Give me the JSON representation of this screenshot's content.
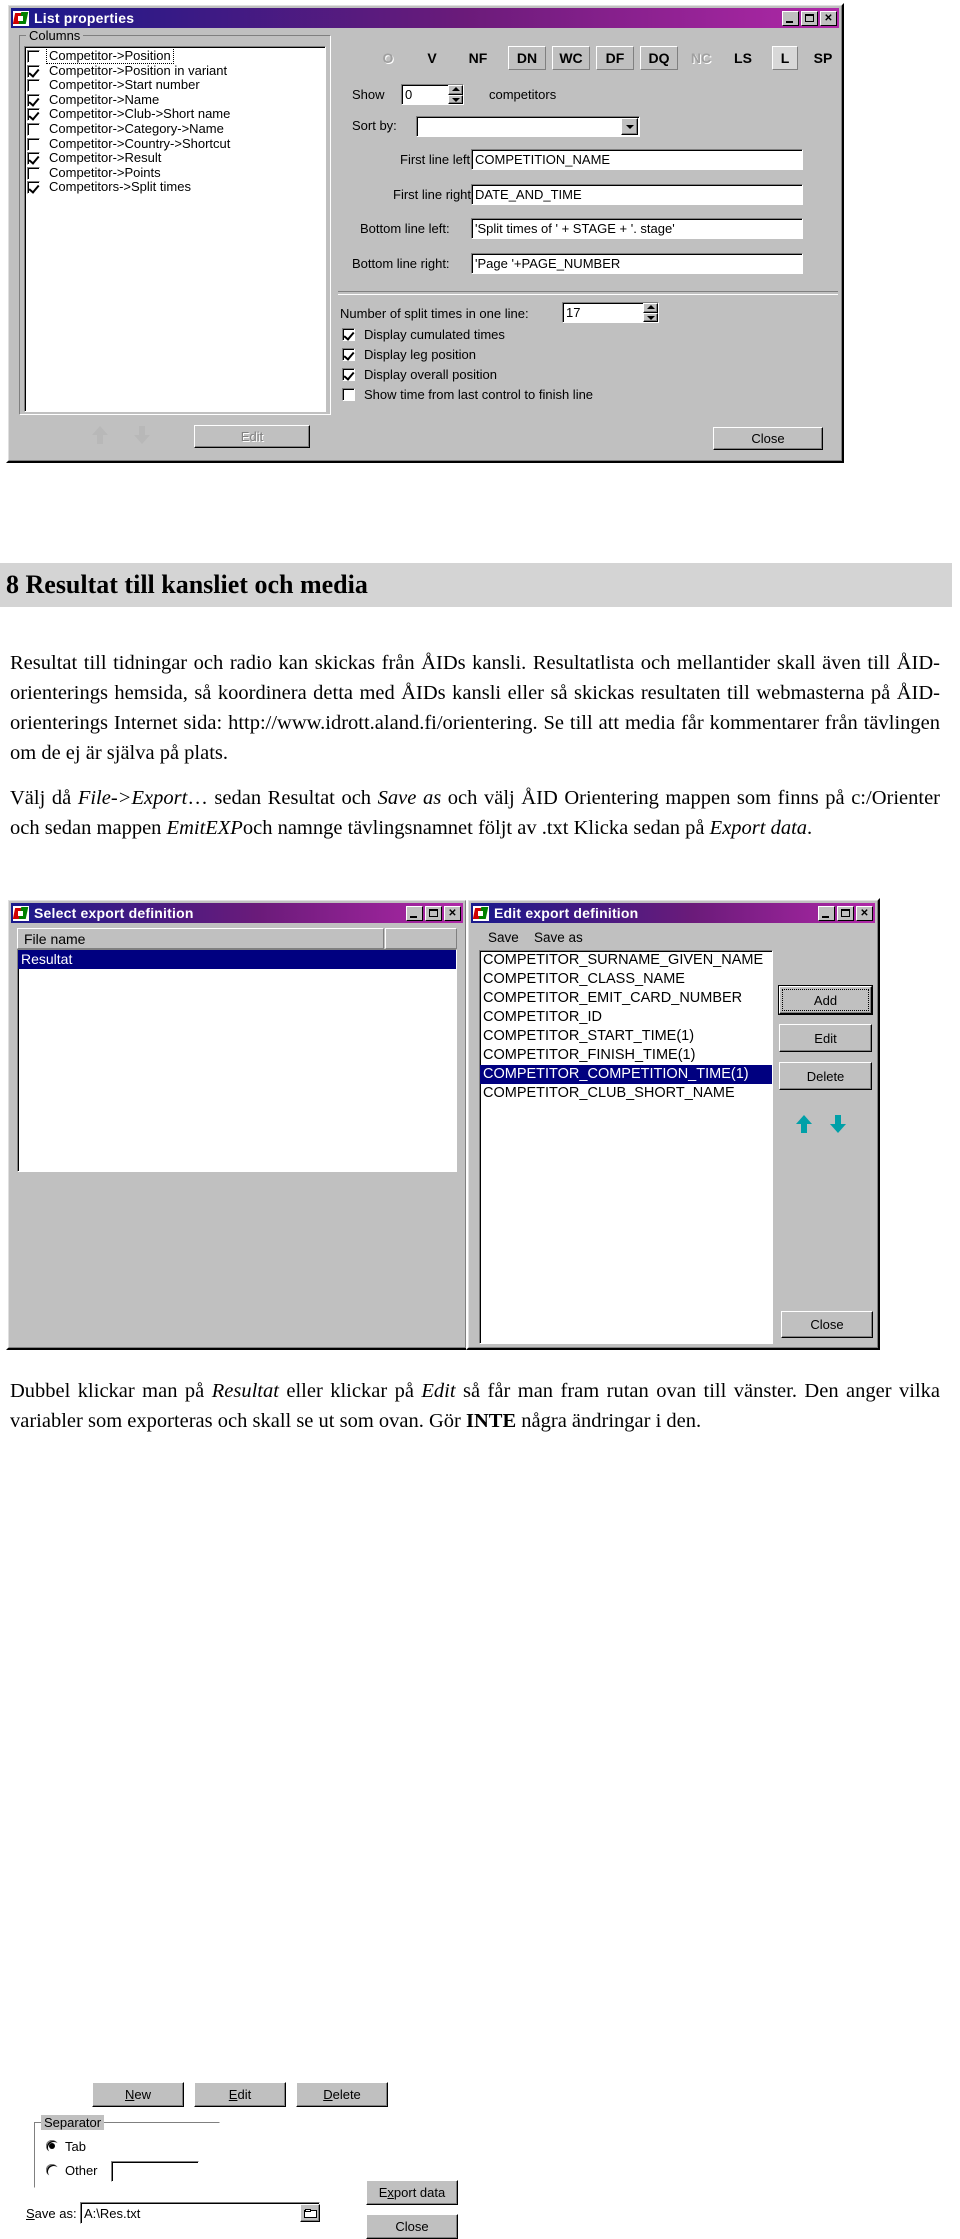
{
  "dialog_list_properties": {
    "title": "List properties",
    "icon": "app-flag-icon",
    "window_buttons": {
      "minimize": "_",
      "maximize": "□",
      "close": "✕"
    },
    "columns_group_label": "Columns",
    "columns": [
      {
        "label": "Competitor->Position",
        "checked": false,
        "focused": true
      },
      {
        "label": "Competitor->Position in variant",
        "checked": true,
        "focused": false
      },
      {
        "label": "Competitor->Start number",
        "checked": false,
        "focused": false
      },
      {
        "label": "Competitor->Name",
        "checked": true,
        "focused": false
      },
      {
        "label": "Competitor->Club->Short name",
        "checked": true,
        "focused": false
      },
      {
        "label": "Competitor->Category->Name",
        "checked": false,
        "focused": false
      },
      {
        "label": "Competitor->Country->Shortcut",
        "checked": false,
        "focused": false
      },
      {
        "label": "Competitor->Result",
        "checked": true,
        "focused": false
      },
      {
        "label": "Competitor->Points",
        "checked": false,
        "focused": false
      },
      {
        "label": "Competitors->Split times",
        "checked": true,
        "focused": false
      }
    ],
    "move_up_label": "move-up",
    "move_down_label": "move-down",
    "edit_button": "Edit",
    "status_toolbar": [
      {
        "label": "O",
        "framed": false,
        "state": "disabled"
      },
      {
        "label": "V",
        "framed": false,
        "state": "normal"
      },
      {
        "label": "NF",
        "framed": false,
        "state": "normal"
      },
      {
        "label": "DN",
        "framed": true,
        "state": "normal"
      },
      {
        "label": "WC",
        "framed": true,
        "state": "normal"
      },
      {
        "label": "DF",
        "framed": true,
        "state": "normal"
      },
      {
        "label": "DQ",
        "framed": true,
        "state": "normal"
      },
      {
        "label": "NC",
        "framed": false,
        "state": "disabled"
      },
      {
        "label": "LS",
        "framed": false,
        "state": "normal"
      },
      {
        "label": "L",
        "framed": true,
        "state": "light"
      },
      {
        "label": "SP",
        "framed": false,
        "state": "normal"
      }
    ],
    "show_label": "Show",
    "show_value": "0",
    "show_suffix": "competitors",
    "sort_by_label": "Sort by:",
    "sort_by_value": "",
    "first_line_left_label": "First line left:",
    "first_line_left_value": "COMPETITION_NAME",
    "first_line_right_label": "First line right:",
    "first_line_right_value": "DATE_AND_TIME",
    "bottom_line_left_label": "Bottom line left:",
    "bottom_line_left_value": "'Split times of ' + STAGE + '. stage'",
    "bottom_line_right_label": "Bottom line right:",
    "bottom_line_right_value": "'Page '+PAGE_NUMBER",
    "split_count_label": "Number of split times in one line:",
    "split_count_value": "17",
    "checkboxes": [
      {
        "label": "Display cumulated times",
        "checked": true
      },
      {
        "label": "Display leg position",
        "checked": true
      },
      {
        "label": "Display overall position",
        "checked": true
      },
      {
        "label": "Show time from last control to finish line",
        "checked": false
      }
    ],
    "close_button": "Close"
  },
  "document": {
    "heading": "8 Resultat till kansliet och media",
    "paragraph1": "Resultat till tidningar och radio kan skickas från ÅIDs kansli. Resultatlista och mellantider skall även till ÅID-orienterings hemsida, så koordinera detta med ÅIDs kansli eller så skickas resultaten till webmasterna på ÅID-orienterings Internet sida: http://www.idrott.aland.fi/orientering. Se till att media får kommentarer från tävlingen om de ej är själva på plats.",
    "paragraph2_parts": [
      {
        "text": "Välj då ",
        "style": "normal"
      },
      {
        "text": "File->Export",
        "style": "italic"
      },
      {
        "text": "… sedan Resultat och ",
        "style": "normal"
      },
      {
        "text": "Save as",
        "style": "italic"
      },
      {
        "text": " och välj ÅID Orientering mappen som finns på c:/Orienter och sedan mappen ",
        "style": "normal"
      },
      {
        "text": "EmitEXP",
        "style": "italic"
      },
      {
        "text": "och namnge tävlingsnamnet följt av .txt Klicka sedan på ",
        "style": "normal"
      },
      {
        "text": "Export data",
        "style": "italic"
      },
      {
        "text": ".",
        "style": "normal"
      }
    ],
    "paragraph3_parts": [
      {
        "text": "Dubbel klickar man på ",
        "style": "normal"
      },
      {
        "text": "Resultat",
        "style": "italic"
      },
      {
        "text": " eller klickar på ",
        "style": "normal"
      },
      {
        "text": "Edit",
        "style": "italic"
      },
      {
        "text": " så får man fram rutan ovan till vänster. Den anger vilka variabler som exporteras och skall se ut som ovan. Gör ",
        "style": "normal"
      },
      {
        "text": "INTE",
        "style": "bold"
      },
      {
        "text": " några ändringar i den.",
        "style": "normal"
      }
    ]
  },
  "dialog_select_export": {
    "title": "Select export definition",
    "icon": "app-flag-icon",
    "window_buttons": {
      "minimize": "_",
      "maximize": "□",
      "close": "✕"
    },
    "column_header": "File name",
    "rows": [
      {
        "label": "Resultat",
        "selected": true
      }
    ],
    "buttons": {
      "new": "New",
      "new_mnemonic": "N",
      "edit": "Edit",
      "edit_mnemonic": "E",
      "delete": "Delete",
      "delete_mnemonic": "D",
      "export_data": "Export data",
      "export_mnemonic": "x",
      "close": "Close"
    },
    "separator_group": "Separator",
    "separator_options": [
      {
        "label": "Tab",
        "selected": true
      },
      {
        "label": "Other",
        "selected": false
      }
    ],
    "separator_other_value": "",
    "save_as_label": "Save as:",
    "save_as_mnemonic": "S",
    "save_as_value": "A:\\Res.txt",
    "browse_icon": "folder-open-icon"
  },
  "dialog_edit_export": {
    "title": "Edit export definition",
    "icon": "app-flag-icon",
    "window_buttons": {
      "minimize": "_",
      "maximize": "□",
      "close": "✕"
    },
    "menu": [
      "Save",
      "Save as"
    ],
    "variables": [
      {
        "label": "COMPETITOR_SURNAME_GIVEN_NAME",
        "selected": false
      },
      {
        "label": "COMPETITOR_CLASS_NAME",
        "selected": false
      },
      {
        "label": "COMPETITOR_EMIT_CARD_NUMBER",
        "selected": false
      },
      {
        "label": "COMPETITOR_ID",
        "selected": false
      },
      {
        "label": "COMPETITOR_START_TIME(1)",
        "selected": false
      },
      {
        "label": "COMPETITOR_FINISH_TIME(1)",
        "selected": false
      },
      {
        "label": "COMPETITOR_COMPETITION_TIME(1)",
        "selected": true
      },
      {
        "label": "COMPETITOR_CLUB_SHORT_NAME",
        "selected": false
      }
    ],
    "buttons": {
      "add": "Add",
      "edit": "Edit",
      "delete": "Delete",
      "close": "Close"
    },
    "move_up_label": "move-up",
    "move_down_label": "move-down",
    "arrow_color": "#00a0a8"
  }
}
